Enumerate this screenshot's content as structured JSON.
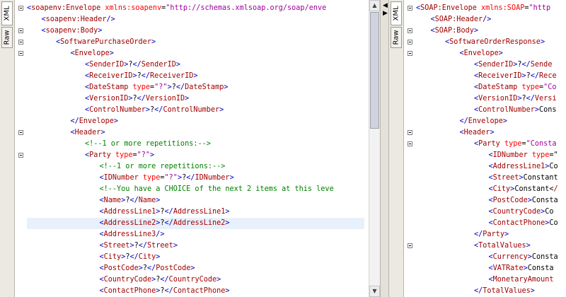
{
  "tabs": {
    "xml": "XML",
    "raw": "Raw"
  },
  "icons": {
    "collapse": "collapse-icon",
    "expand_left": "arrow-left-icon",
    "expand_right": "arrow-right-icon",
    "scroll_up": "scroll-up-icon",
    "scroll_down": "scroll-down-icon"
  },
  "colors": {
    "prefix": "#0000c0",
    "element": "#a00000",
    "attribute": "#ff0000",
    "value": "#a000a0",
    "comment": "#008000",
    "highlight": "#e8f0fb"
  },
  "left": {
    "lines": [
      {
        "indent": 0,
        "fold": true,
        "t": [
          [
            "p",
            "<"
          ],
          [
            "e",
            "soapenv:Envelope"
          ],
          [
            "a",
            " xmlns:soapenv"
          ],
          [
            "t",
            "="
          ],
          [
            "v",
            "\"http://schemas.xmlsoap.org/soap/enve"
          ]
        ]
      },
      {
        "indent": 1,
        "fold": false,
        "t": [
          [
            "p",
            "<"
          ],
          [
            "e",
            "soapenv:Header"
          ],
          [
            "p",
            "/>"
          ]
        ]
      },
      {
        "indent": 1,
        "fold": true,
        "t": [
          [
            "p",
            "<"
          ],
          [
            "e",
            "soapenv:Body"
          ],
          [
            "p",
            ">"
          ]
        ]
      },
      {
        "indent": 2,
        "fold": true,
        "t": [
          [
            "p",
            "<"
          ],
          [
            "e",
            "SoftwarePurchaseOrder"
          ],
          [
            "p",
            ">"
          ]
        ]
      },
      {
        "indent": 3,
        "fold": true,
        "t": [
          [
            "p",
            "<"
          ],
          [
            "e",
            "Envelope"
          ],
          [
            "p",
            ">"
          ]
        ]
      },
      {
        "indent": 4,
        "fold": false,
        "t": [
          [
            "p",
            "<"
          ],
          [
            "e",
            "SenderID"
          ],
          [
            "p",
            ">"
          ],
          [
            "t",
            "?"
          ],
          [
            "p",
            "</"
          ],
          [
            "e",
            "SenderID"
          ],
          [
            "p",
            ">"
          ]
        ]
      },
      {
        "indent": 4,
        "fold": false,
        "t": [
          [
            "p",
            "<"
          ],
          [
            "e",
            "ReceiverID"
          ],
          [
            "p",
            ">"
          ],
          [
            "t",
            "?"
          ],
          [
            "p",
            "</"
          ],
          [
            "e",
            "ReceiverID"
          ],
          [
            "p",
            ">"
          ]
        ]
      },
      {
        "indent": 4,
        "fold": false,
        "t": [
          [
            "p",
            "<"
          ],
          [
            "e",
            "DateStamp"
          ],
          [
            "a",
            " type"
          ],
          [
            "t",
            "="
          ],
          [
            "v",
            "\"?\""
          ],
          [
            "p",
            ">"
          ],
          [
            "t",
            "?"
          ],
          [
            "p",
            "</"
          ],
          [
            "e",
            "DateStamp"
          ],
          [
            "p",
            ">"
          ]
        ]
      },
      {
        "indent": 4,
        "fold": false,
        "t": [
          [
            "p",
            "<"
          ],
          [
            "e",
            "VersionID"
          ],
          [
            "p",
            ">"
          ],
          [
            "t",
            "?"
          ],
          [
            "p",
            "</"
          ],
          [
            "e",
            "VersionID"
          ],
          [
            "p",
            ">"
          ]
        ]
      },
      {
        "indent": 4,
        "fold": false,
        "t": [
          [
            "p",
            "<"
          ],
          [
            "e",
            "ControlNumber"
          ],
          [
            "p",
            ">"
          ],
          [
            "t",
            "?"
          ],
          [
            "p",
            "</"
          ],
          [
            "e",
            "ControlNumber"
          ],
          [
            "p",
            ">"
          ]
        ]
      },
      {
        "indent": 3,
        "fold": false,
        "t": [
          [
            "p",
            "</"
          ],
          [
            "e",
            "Envelope"
          ],
          [
            "p",
            ">"
          ]
        ]
      },
      {
        "indent": 3,
        "fold": true,
        "t": [
          [
            "p",
            "<"
          ],
          [
            "e",
            "Header"
          ],
          [
            "p",
            ">"
          ]
        ]
      },
      {
        "indent": 4,
        "fold": false,
        "t": [
          [
            "c",
            "<!--1 or more repetitions:-->"
          ]
        ]
      },
      {
        "indent": 4,
        "fold": true,
        "t": [
          [
            "p",
            "<"
          ],
          [
            "e",
            "Party"
          ],
          [
            "a",
            " type"
          ],
          [
            "t",
            "="
          ],
          [
            "v",
            "\"?\""
          ],
          [
            "p",
            ">"
          ]
        ]
      },
      {
        "indent": 5,
        "fold": false,
        "t": [
          [
            "c",
            "<!--1 or more repetitions:-->"
          ]
        ]
      },
      {
        "indent": 5,
        "fold": false,
        "t": [
          [
            "p",
            "<"
          ],
          [
            "e",
            "IDNumber"
          ],
          [
            "a",
            " type"
          ],
          [
            "t",
            "="
          ],
          [
            "v",
            "\"?\""
          ],
          [
            "p",
            ">"
          ],
          [
            "t",
            "?"
          ],
          [
            "p",
            "</"
          ],
          [
            "e",
            "IDNumber"
          ],
          [
            "p",
            ">"
          ]
        ]
      },
      {
        "indent": 5,
        "fold": false,
        "t": [
          [
            "c",
            "<!--You have a CHOICE of the next 2 items at this leve"
          ]
        ]
      },
      {
        "indent": 5,
        "fold": false,
        "t": [
          [
            "p",
            "<"
          ],
          [
            "e",
            "Name"
          ],
          [
            "p",
            ">"
          ],
          [
            "t",
            "?"
          ],
          [
            "p",
            "</"
          ],
          [
            "e",
            "Name"
          ],
          [
            "p",
            ">"
          ]
        ]
      },
      {
        "indent": 5,
        "fold": false,
        "t": [
          [
            "p",
            "<"
          ],
          [
            "e",
            "AddressLine1"
          ],
          [
            "p",
            ">"
          ],
          [
            "t",
            "?"
          ],
          [
            "p",
            "</"
          ],
          [
            "e",
            "AddressLine1"
          ],
          [
            "p",
            ">"
          ]
        ]
      },
      {
        "indent": 5,
        "fold": false,
        "hl": true,
        "t": [
          [
            "p",
            "<"
          ],
          [
            "e",
            "AddressLine2"
          ],
          [
            "p",
            ">"
          ],
          [
            "t",
            "?"
          ],
          [
            "p",
            "</"
          ],
          [
            "e",
            "AddressLine2"
          ],
          [
            "p",
            ">"
          ]
        ]
      },
      {
        "indent": 5,
        "fold": false,
        "t": [
          [
            "p",
            "<"
          ],
          [
            "e",
            "AddressLine3"
          ],
          [
            "p",
            "/>"
          ]
        ]
      },
      {
        "indent": 5,
        "fold": false,
        "t": [
          [
            "p",
            "<"
          ],
          [
            "e",
            "Street"
          ],
          [
            "p",
            ">"
          ],
          [
            "t",
            "?"
          ],
          [
            "p",
            "</"
          ],
          [
            "e",
            "Street"
          ],
          [
            "p",
            ">"
          ]
        ]
      },
      {
        "indent": 5,
        "fold": false,
        "t": [
          [
            "p",
            "<"
          ],
          [
            "e",
            "City"
          ],
          [
            "p",
            ">"
          ],
          [
            "t",
            "?"
          ],
          [
            "p",
            "</"
          ],
          [
            "e",
            "City"
          ],
          [
            "p",
            ">"
          ]
        ]
      },
      {
        "indent": 5,
        "fold": false,
        "t": [
          [
            "p",
            "<"
          ],
          [
            "e",
            "PostCode"
          ],
          [
            "p",
            ">"
          ],
          [
            "t",
            "?"
          ],
          [
            "p",
            "</"
          ],
          [
            "e",
            "PostCode"
          ],
          [
            "p",
            ">"
          ]
        ]
      },
      {
        "indent": 5,
        "fold": false,
        "t": [
          [
            "p",
            "<"
          ],
          [
            "e",
            "CountryCode"
          ],
          [
            "p",
            ">"
          ],
          [
            "t",
            "?"
          ],
          [
            "p",
            "</"
          ],
          [
            "e",
            "CountryCode"
          ],
          [
            "p",
            ">"
          ]
        ]
      },
      {
        "indent": 5,
        "fold": false,
        "t": [
          [
            "p",
            "<"
          ],
          [
            "e",
            "ContactPhone"
          ],
          [
            "p",
            ">"
          ],
          [
            "t",
            "?"
          ],
          [
            "p",
            "</"
          ],
          [
            "e",
            "ContactPhone"
          ],
          [
            "p",
            ">"
          ]
        ]
      }
    ]
  },
  "right": {
    "lines": [
      {
        "indent": 0,
        "fold": true,
        "t": [
          [
            "p",
            "<"
          ],
          [
            "e",
            "SOAP:Envelope"
          ],
          [
            "a",
            " xmlns:SOAP"
          ],
          [
            "t",
            "="
          ],
          [
            "v",
            "\"http"
          ]
        ]
      },
      {
        "indent": 1,
        "fold": false,
        "t": [
          [
            "p",
            "<"
          ],
          [
            "e",
            "SOAP:Header"
          ],
          [
            "p",
            "/>"
          ]
        ]
      },
      {
        "indent": 1,
        "fold": true,
        "t": [
          [
            "p",
            "<"
          ],
          [
            "e",
            "SOAP:Body"
          ],
          [
            "p",
            ">"
          ]
        ]
      },
      {
        "indent": 2,
        "fold": true,
        "t": [
          [
            "p",
            "<"
          ],
          [
            "e",
            "SoftwareOrderResponse"
          ],
          [
            "p",
            ">"
          ]
        ]
      },
      {
        "indent": 3,
        "fold": true,
        "t": [
          [
            "p",
            "<"
          ],
          [
            "e",
            "Envelope"
          ],
          [
            "p",
            ">"
          ]
        ]
      },
      {
        "indent": 4,
        "fold": false,
        "t": [
          [
            "p",
            "<"
          ],
          [
            "e",
            "SenderID"
          ],
          [
            "p",
            ">"
          ],
          [
            "t",
            "?"
          ],
          [
            "p",
            "</"
          ],
          [
            "e",
            "Sende"
          ]
        ]
      },
      {
        "indent": 4,
        "fold": false,
        "t": [
          [
            "p",
            "<"
          ],
          [
            "e",
            "ReceiverID"
          ],
          [
            "p",
            ">"
          ],
          [
            "t",
            "?"
          ],
          [
            "p",
            "</"
          ],
          [
            "e",
            "Rece"
          ]
        ]
      },
      {
        "indent": 4,
        "fold": false,
        "t": [
          [
            "p",
            "<"
          ],
          [
            "e",
            "DateStamp"
          ],
          [
            "a",
            " type"
          ],
          [
            "t",
            "="
          ],
          [
            "v",
            "\"Co"
          ]
        ]
      },
      {
        "indent": 4,
        "fold": false,
        "t": [
          [
            "p",
            "<"
          ],
          [
            "e",
            "VersionID"
          ],
          [
            "p",
            ">"
          ],
          [
            "t",
            "?"
          ],
          [
            "p",
            "</"
          ],
          [
            "e",
            "Versi"
          ]
        ]
      },
      {
        "indent": 4,
        "fold": false,
        "t": [
          [
            "p",
            "<"
          ],
          [
            "e",
            "ControlNumber"
          ],
          [
            "p",
            ">"
          ],
          [
            "t",
            "Cons"
          ]
        ]
      },
      {
        "indent": 3,
        "fold": false,
        "t": [
          [
            "p",
            "</"
          ],
          [
            "e",
            "Envelope"
          ],
          [
            "p",
            ">"
          ]
        ]
      },
      {
        "indent": 3,
        "fold": true,
        "t": [
          [
            "p",
            "<"
          ],
          [
            "e",
            "Header"
          ],
          [
            "p",
            ">"
          ]
        ]
      },
      {
        "indent": 4,
        "fold": true,
        "t": [
          [
            "p",
            "<"
          ],
          [
            "e",
            "Party"
          ],
          [
            "a",
            " type"
          ],
          [
            "t",
            "="
          ],
          [
            "v",
            "\"Consta"
          ]
        ]
      },
      {
        "indent": 5,
        "fold": false,
        "t": [
          [
            "p",
            "<"
          ],
          [
            "e",
            "IDNumber"
          ],
          [
            "a",
            " type"
          ],
          [
            "t",
            "=\""
          ]
        ]
      },
      {
        "indent": 5,
        "fold": false,
        "t": [
          [
            "p",
            "<"
          ],
          [
            "e",
            "AddressLine1"
          ],
          [
            "p",
            ">"
          ],
          [
            "t",
            "Co"
          ]
        ]
      },
      {
        "indent": 5,
        "fold": false,
        "t": [
          [
            "p",
            "<"
          ],
          [
            "e",
            "Street"
          ],
          [
            "p",
            ">"
          ],
          [
            "t",
            "Constant"
          ]
        ]
      },
      {
        "indent": 5,
        "fold": false,
        "t": [
          [
            "p",
            "<"
          ],
          [
            "e",
            "City"
          ],
          [
            "p",
            ">"
          ],
          [
            "t",
            "Constant<"
          ],
          [
            "e",
            "/"
          ]
        ]
      },
      {
        "indent": 5,
        "fold": false,
        "t": [
          [
            "p",
            "<"
          ],
          [
            "e",
            "PostCode"
          ],
          [
            "p",
            ">"
          ],
          [
            "t",
            "Consta"
          ]
        ]
      },
      {
        "indent": 5,
        "fold": false,
        "t": [
          [
            "p",
            "<"
          ],
          [
            "e",
            "CountryCode"
          ],
          [
            "p",
            ">"
          ],
          [
            "t",
            "Co"
          ]
        ]
      },
      {
        "indent": 5,
        "fold": false,
        "t": [
          [
            "p",
            "<"
          ],
          [
            "e",
            "ContactPhone"
          ],
          [
            "p",
            ">"
          ],
          [
            "t",
            "Co"
          ]
        ]
      },
      {
        "indent": 4,
        "fold": false,
        "t": [
          [
            "p",
            "</"
          ],
          [
            "e",
            "Party"
          ],
          [
            "p",
            ">"
          ]
        ]
      },
      {
        "indent": 4,
        "fold": true,
        "t": [
          [
            "p",
            "<"
          ],
          [
            "e",
            "TotalValues"
          ],
          [
            "p",
            ">"
          ]
        ]
      },
      {
        "indent": 5,
        "fold": false,
        "t": [
          [
            "p",
            "<"
          ],
          [
            "e",
            "Currency"
          ],
          [
            "p",
            ">"
          ],
          [
            "t",
            "Consta"
          ]
        ]
      },
      {
        "indent": 5,
        "fold": false,
        "t": [
          [
            "p",
            "<"
          ],
          [
            "e",
            "VATRate"
          ],
          [
            "p",
            ">"
          ],
          [
            "t",
            "Consta"
          ]
        ]
      },
      {
        "indent": 5,
        "fold": false,
        "t": [
          [
            "p",
            "<"
          ],
          [
            "e",
            "MonetaryAmount"
          ]
        ]
      },
      {
        "indent": 4,
        "fold": false,
        "t": [
          [
            "p",
            "</"
          ],
          [
            "e",
            "TotalValues"
          ],
          [
            "p",
            ">"
          ]
        ]
      }
    ]
  }
}
